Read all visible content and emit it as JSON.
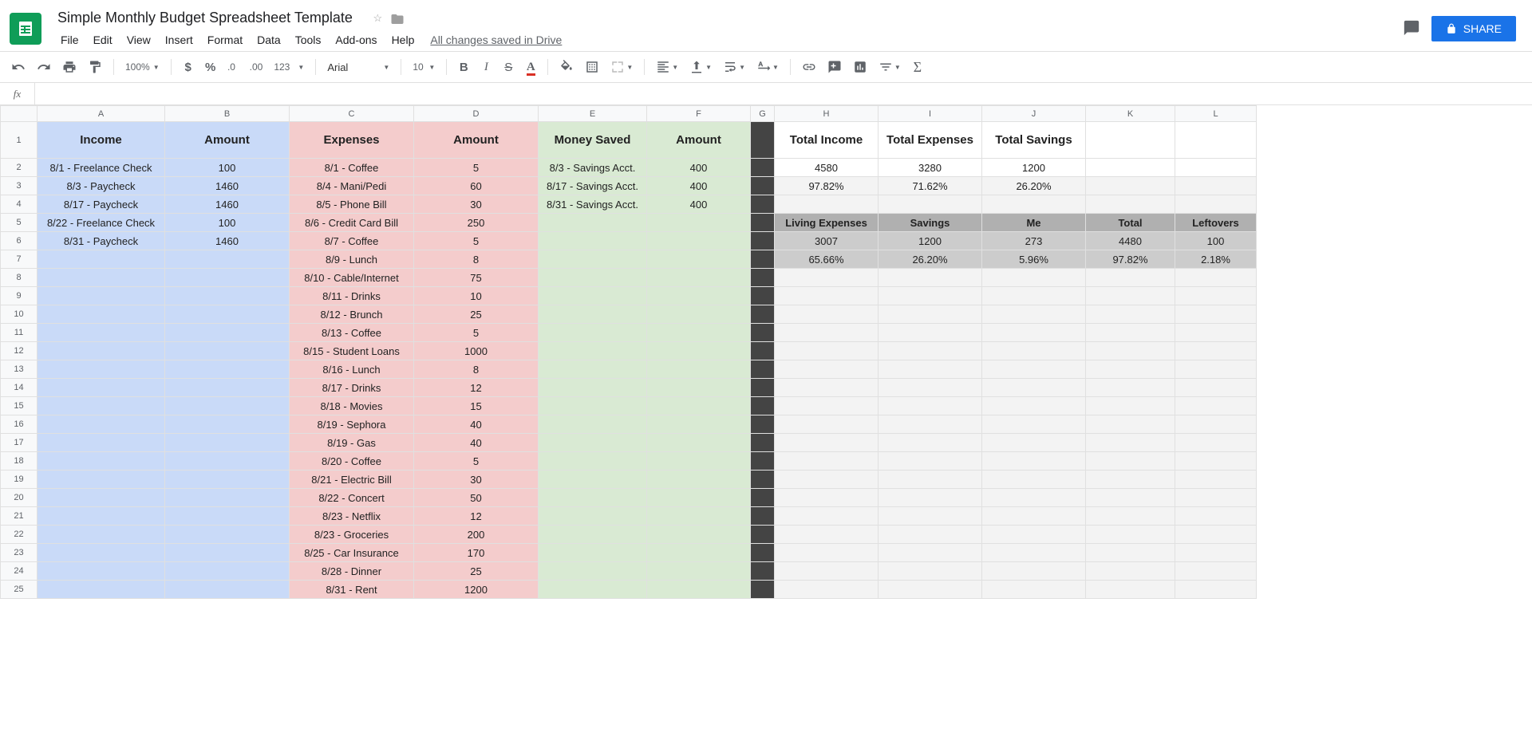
{
  "doc": {
    "title": "Simple Monthly Budget Spreadsheet Template",
    "saved": "All changes saved in Drive"
  },
  "menu": [
    "File",
    "Edit",
    "View",
    "Insert",
    "Format",
    "Data",
    "Tools",
    "Add-ons",
    "Help"
  ],
  "share": "SHARE",
  "toolbar": {
    "zoom": "100%",
    "format123": "123",
    "font": "Arial",
    "fontsize": "10"
  },
  "cols": [
    "A",
    "B",
    "C",
    "D",
    "E",
    "F",
    "G",
    "H",
    "I",
    "J",
    "K",
    "L"
  ],
  "headers": {
    "income": "Income",
    "amount1": "Amount",
    "expenses": "Expenses",
    "amount2": "Amount",
    "saved": "Money Saved",
    "amount3": "Amount",
    "totInc": "Total Income",
    "totExp": "Total Expenses",
    "totSav": "Total Savings",
    "living": "Living Expenses",
    "savings": "Savings",
    "me": "Me",
    "total": "Total",
    "leftovers": "Leftovers"
  },
  "rows": [
    {
      "a": "8/1 - Freelance Check",
      "b": "100",
      "c": "8/1 - Coffee",
      "d": "5",
      "e": "8/3 - Savings Acct.",
      "f": "400",
      "h": "4580",
      "i": "3280",
      "j": "1200"
    },
    {
      "a": "8/3 - Paycheck",
      "b": "1460",
      "c": "8/4 - Mani/Pedi",
      "d": "60",
      "e": "8/17 - Savings Acct.",
      "f": "400",
      "h": "97.82%",
      "i": "71.62%",
      "j": "26.20%"
    },
    {
      "a": "8/17 - Paycheck",
      "b": "1460",
      "c": "8/5 - Phone Bill",
      "d": "30",
      "e": "8/31 - Savings Acct.",
      "f": "400"
    },
    {
      "a": "8/22 - Freelance Check",
      "b": "100",
      "c": "8/6 - Credit Card Bill",
      "d": "250",
      "sum2": true
    },
    {
      "a": "8/31 - Paycheck",
      "b": "1460",
      "c": "8/7 - Coffee",
      "d": "5",
      "h": "3007",
      "i": "1200",
      "j": "273",
      "k": "4480",
      "l": "100",
      "cls": "greyl"
    },
    {
      "c": "8/9 - Lunch",
      "d": "8",
      "h": "65.66%",
      "i": "26.20%",
      "j": "5.96%",
      "k": "97.82%",
      "l": "2.18%",
      "cls": "greyl"
    },
    {
      "c": "8/10 - Cable/Internet",
      "d": "75"
    },
    {
      "c": "8/11 - Drinks",
      "d": "10"
    },
    {
      "c": "8/12 - Brunch",
      "d": "25"
    },
    {
      "c": "8/13 - Coffee",
      "d": "5"
    },
    {
      "c": "8/15 - Student Loans",
      "d": "1000"
    },
    {
      "c": "8/16 - Lunch",
      "d": "8"
    },
    {
      "c": "8/17 - Drinks",
      "d": "12"
    },
    {
      "c": "8/18 - Movies",
      "d": "15"
    },
    {
      "c": "8/19 - Sephora",
      "d": "40"
    },
    {
      "c": "8/19 - Gas",
      "d": "40"
    },
    {
      "c": "8/20 - Coffee",
      "d": "5"
    },
    {
      "c": "8/21 - Electric Bill",
      "d": "30"
    },
    {
      "c": "8/22 - Concert",
      "d": "50"
    },
    {
      "c": "8/23 - Netflix",
      "d": "12"
    },
    {
      "c": "8/23 - Groceries",
      "d": "200"
    },
    {
      "c": "8/25 - Car Insurance",
      "d": "170"
    },
    {
      "c": "8/28 - Dinner",
      "d": "25"
    },
    {
      "c": "8/31 - Rent",
      "d": "1200"
    }
  ]
}
